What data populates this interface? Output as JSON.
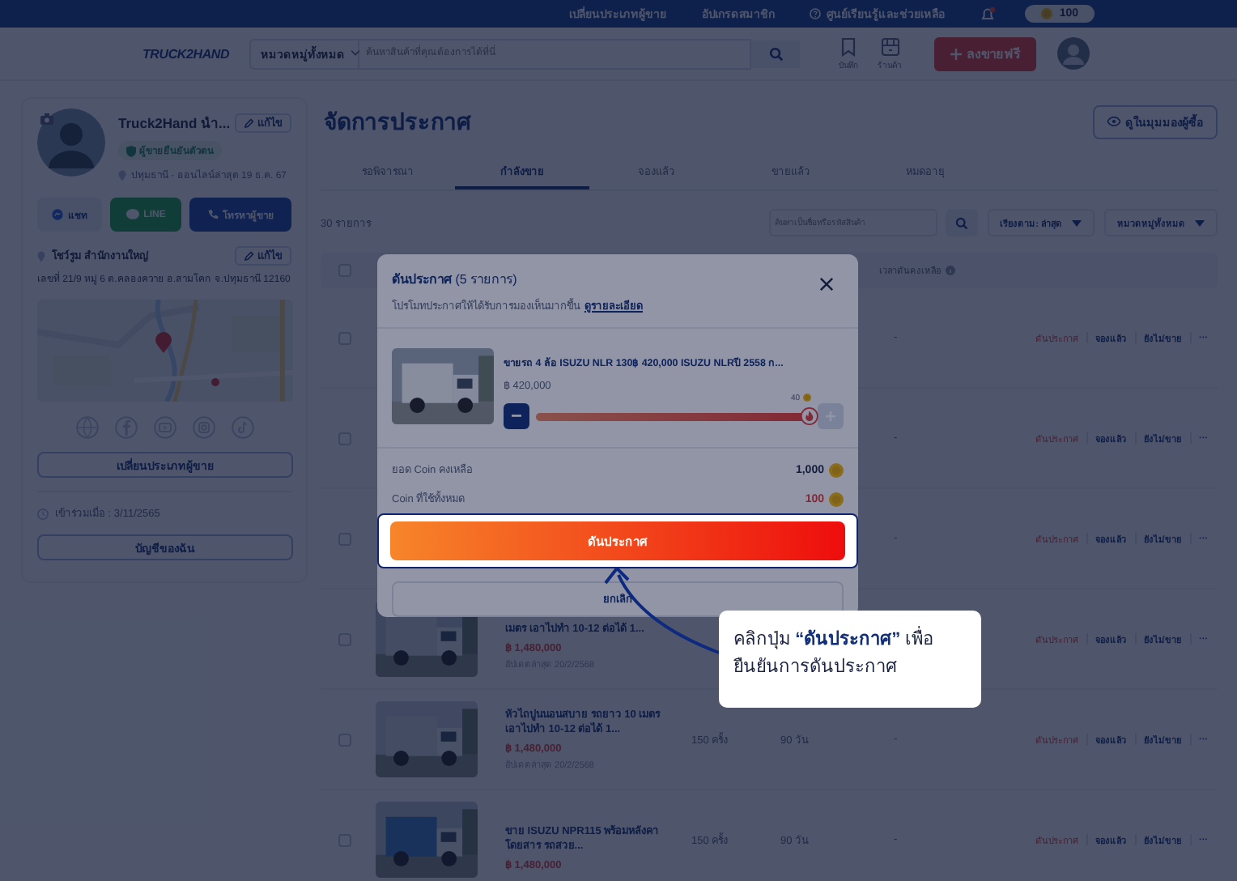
{
  "top_bar": {
    "links": [
      "เปลี่ยนประเภทผู้ขาย",
      "อัปเกรดสมาชิก",
      "ศูนย์เรียนรู้และช่วยเหลือ"
    ],
    "coins": "100"
  },
  "header": {
    "logo": "TRUCK2HAND",
    "category": "หมวดหมู่ทั้งหมด",
    "search_placeholder": "ค้นหาสินค้าที่คุณต้องการได้ที่นี่",
    "icons": [
      {
        "kind": "bookmark",
        "label": "บันทึก"
      },
      {
        "kind": "store",
        "label": "ร้านค้า"
      }
    ],
    "post_button": "ลงขายฟรี"
  },
  "seller": {
    "name": "Truck2Hand นำ...",
    "edit": "แก้ไข",
    "badge": "ผู้ขายยืนยันตัวตน",
    "location": "ปทุมธานี · ออนไลน์ล่าสุด 19 ธ.ค. 67",
    "contacts": [
      {
        "kind": "chat",
        "label": "แชท"
      },
      {
        "kind": "line",
        "label": "LINE"
      },
      {
        "kind": "phone",
        "label": "โทรหาผู้ขาย"
      }
    ],
    "branch": "โชว์รูม สำนักงานใหญ่",
    "branch_edit": "แก้ไข",
    "address": "เลขที่ 21/9 หมู่ 6 ต.คลองควาย อ.สามโคก จ.ปทุมธานี 12160",
    "switch_button": "เปลี่ยนประเภทผู้ขาย",
    "joined": "เข้าร่วมเมื่อ : 3/11/2565",
    "account_button": "บัญชีของฉัน"
  },
  "main": {
    "title": "จัดการประกาศ",
    "buyer_view": "ดูในมุมมองผู้ซื้อ",
    "tabs": [
      {
        "label": "รอพิจารณา",
        "selected": false
      },
      {
        "label": "กำลังขาย",
        "selected": true
      },
      {
        "label": "จองแล้ว",
        "selected": false
      },
      {
        "label": "ขายแล้ว",
        "selected": false
      },
      {
        "label": "หมดอายุ",
        "selected": false
      }
    ],
    "count": "30 รายการ",
    "search_placeholder": "ค้นหาเป็นชื่อหรือรหัสสินค้า",
    "sort": "เรียงตาม: ล่าสุด",
    "category": "หมวดหมู่ทั้งหมด"
  },
  "table": {
    "header_checked": false,
    "columns": [
      {
        "label": "เวลาดันคงเหลือ"
      }
    ],
    "rows": [
      {
        "checked": false,
        "boost_time": "-",
        "actions": [
          {
            "kind": "boost",
            "label": "ดันประกาศ"
          },
          {
            "kind": "status",
            "label": "จองแล้ว"
          },
          {
            "kind": "status",
            "label": "ยังไม่ขาย"
          },
          {
            "kind": "more",
            "label": "···"
          }
        ]
      },
      {
        "checked": false,
        "boost_time": "-",
        "actions": [
          {
            "kind": "boost",
            "label": "ดันประกาศ"
          },
          {
            "kind": "status",
            "label": "จองแล้ว"
          },
          {
            "kind": "status",
            "label": "ยังไม่ขาย"
          },
          {
            "kind": "more",
            "label": "···"
          }
        ]
      },
      {
        "checked": false,
        "boost_time": "-",
        "actions": [
          {
            "kind": "boost",
            "label": "ดันประกาศ"
          },
          {
            "kind": "status",
            "label": "จองแล้ว"
          },
          {
            "kind": "status",
            "label": "ยังไม่ขาย"
          },
          {
            "kind": "more",
            "label": "···"
          }
        ]
      },
      {
        "checked": false,
        "title": "เมตร เอาไปทำ 10-12 ต่อได้ 1...",
        "price": "฿ 1,480,000",
        "updated": "อัปเดตล่าสุด 20/2/2568",
        "actions": [
          {
            "kind": "boost",
            "label": "ดันประกาศ"
          },
          {
            "kind": "status",
            "label": "จองแล้ว"
          },
          {
            "kind": "status",
            "label": "ยังไม่ขาย"
          },
          {
            "kind": "more",
            "label": "···"
          }
        ]
      },
      {
        "checked": false,
        "title": "หัวไถปูนนอนสบาย รถยาว 10 เมตร เอาไปทำ 10-12 ต่อได้ 1...",
        "price": "฿ 1,480,000",
        "updated": "อัปเดตล่าสุด 20/2/2568",
        "views": "150 ครั้ง",
        "days": "90 วัน",
        "boost_time": "-",
        "actions": [
          {
            "kind": "boost",
            "label": "ดันประกาศ"
          },
          {
            "kind": "status",
            "label": "จองแล้ว"
          },
          {
            "kind": "status",
            "label": "ยังไม่ขาย"
          },
          {
            "kind": "more",
            "label": "···"
          }
        ]
      },
      {
        "checked": false,
        "title": "ขาย ISUZU NPR115 พร้อมหลังคาโดยสาร รถสวย...",
        "price": "฿ 1,480,000",
        "views": "150 ครั้ง",
        "days": "90 วัน",
        "boost_time": "-",
        "actions": [
          {
            "kind": "boost",
            "label": "ดันประกาศ"
          },
          {
            "kind": "status",
            "label": "จองแล้ว"
          },
          {
            "kind": "status",
            "label": "ยังไม่ขาย"
          },
          {
            "kind": "more",
            "label": "···"
          }
        ]
      }
    ]
  },
  "modal": {
    "title": "ดันประกาศ",
    "title_count": "(5 รายการ)",
    "subtitle": "โปรโมทประกาศให้ได้รับการมองเห็นมากขึ้น",
    "details_link": "ดูรายละเอียด",
    "item": {
      "title": "ขายรถ 4 ล้อ ISUZU NLR 130฿ 420,000 ISUZU NLRปี 2558 ก...",
      "price": "฿ 420,000",
      "boost_coins": "40",
      "level": 1
    },
    "balance_label": "ยอด Coin คงเหลือ",
    "balance": "1,000",
    "cost_label": "Coin ที่ใช้ทั้งหมด",
    "cost": "100",
    "confirm_button": "ดันประกาศ",
    "cancel_button": "ยกเลิก"
  },
  "tour": {
    "text": "คลิกปุ่ม **“ดันประกาศ”** เพื่อยืนยันการดันประกาศ"
  }
}
